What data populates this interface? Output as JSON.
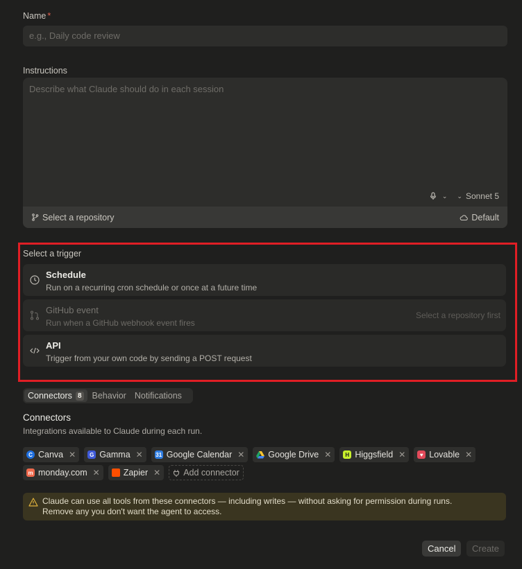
{
  "name_field": {
    "label": "Name",
    "required_mark": "*",
    "placeholder": "e.g., Daily code review"
  },
  "instructions": {
    "label": "Instructions",
    "placeholder": "Describe what Claude should do in each session",
    "mic_icon": "microphone-icon",
    "model": "Sonnet 5",
    "repo_button": "Select a repository",
    "env_button": "Default"
  },
  "trigger": {
    "label": "Select a trigger",
    "options": [
      {
        "title": "Schedule",
        "desc": "Run on a recurring cron schedule or once at a future time",
        "icon": "clock-icon"
      },
      {
        "title": "GitHub event",
        "desc": "Run when a GitHub webhook event fires",
        "icon": "git-pull-request-icon",
        "hint": "Select a repository first"
      },
      {
        "title": "API",
        "desc": "Trigger from your own code by sending a POST request",
        "icon": "code-icon"
      }
    ]
  },
  "tabs": {
    "connectors": "Connectors",
    "connectors_count": "8",
    "behavior": "Behavior",
    "notifications": "Notifications"
  },
  "connectors": {
    "title": "Connectors",
    "subtitle": "Integrations available to Claude during each run.",
    "items": [
      {
        "name": "Canva",
        "color": "#1e6fe0"
      },
      {
        "name": "Gamma",
        "color": "#3f5ad8"
      },
      {
        "name": "Google Calendar",
        "color": "#2f7de1"
      },
      {
        "name": "Google Drive",
        "color": "#1fa463"
      },
      {
        "name": "Higgsfield",
        "color": "#c8f02c"
      },
      {
        "name": "Lovable",
        "color": "#e24a5a"
      },
      {
        "name": "monday.com",
        "color": "#f06a4d"
      },
      {
        "name": "Zapier",
        "color": "#ff4f00"
      }
    ],
    "add_label": "Add connector"
  },
  "warning": {
    "line1": "Claude can use all tools from these connectors — including writes — without asking for permission during runs.",
    "line2": "Remove any you don't want the agent to access."
  },
  "actions": {
    "cancel": "Cancel",
    "create": "Create"
  },
  "colors": {
    "background": "#1f1f1e",
    "highlight_border": "#e01e25",
    "warning_bg": "#3a3520"
  }
}
